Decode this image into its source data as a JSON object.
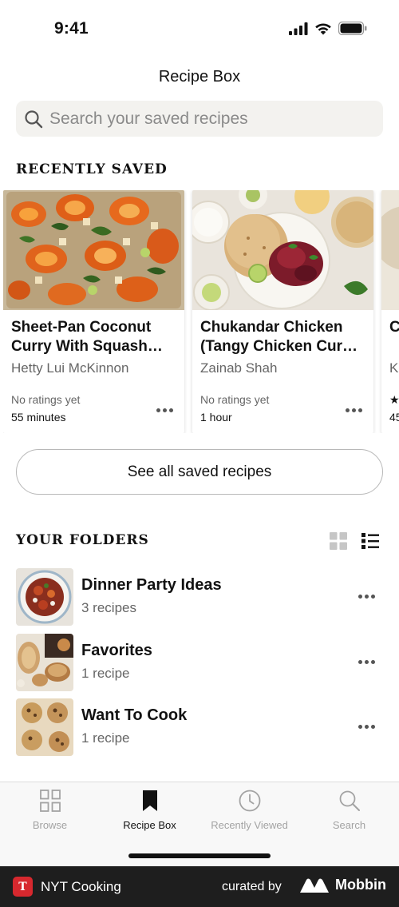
{
  "status_bar": {
    "time": "9:41"
  },
  "header": {
    "title": "Recipe Box"
  },
  "search": {
    "placeholder": "Search your saved recipes"
  },
  "recently_saved": {
    "heading": "RECENTLY SAVED",
    "cards": [
      {
        "title": "Sheet-Pan Coconut Curry With Squash…",
        "author": "Hetty Lui McKinnon",
        "rating": "No ratings yet",
        "time": "55 minutes"
      },
      {
        "title": "Chukandar Chicken (Tangy Chicken Cur…",
        "author": "Zainab Shah",
        "rating": "No ratings yet",
        "time": "1 hour"
      },
      {
        "title": "C",
        "author": "K",
        "rating": "★",
        "time": "45"
      }
    ]
  },
  "see_all_button": {
    "label": "See all saved recipes"
  },
  "folders": {
    "heading": "YOUR FOLDERS",
    "items": [
      {
        "name": "Dinner Party Ideas",
        "count": "3 recipes"
      },
      {
        "name": "Favorites",
        "count": "1 recipe"
      },
      {
        "name": "Want To Cook",
        "count": "1 recipe"
      }
    ]
  },
  "tab_bar": {
    "tabs": [
      {
        "label": "Browse",
        "icon": "grid-icon"
      },
      {
        "label": "Recipe Box",
        "icon": "bookmark-icon",
        "active": true
      },
      {
        "label": "Recently Viewed",
        "icon": "clock-icon"
      },
      {
        "label": "Search",
        "icon": "search-icon"
      }
    ]
  },
  "footer": {
    "app_name": "NYT Cooking",
    "curated_by": "curated by",
    "brand": "Mobbin"
  },
  "colors": {
    "text": "#121212",
    "muted": "#666666",
    "search_bg": "#f3f2ef",
    "footer_bg": "#1e1e1e",
    "logo_red": "#d7282e"
  }
}
